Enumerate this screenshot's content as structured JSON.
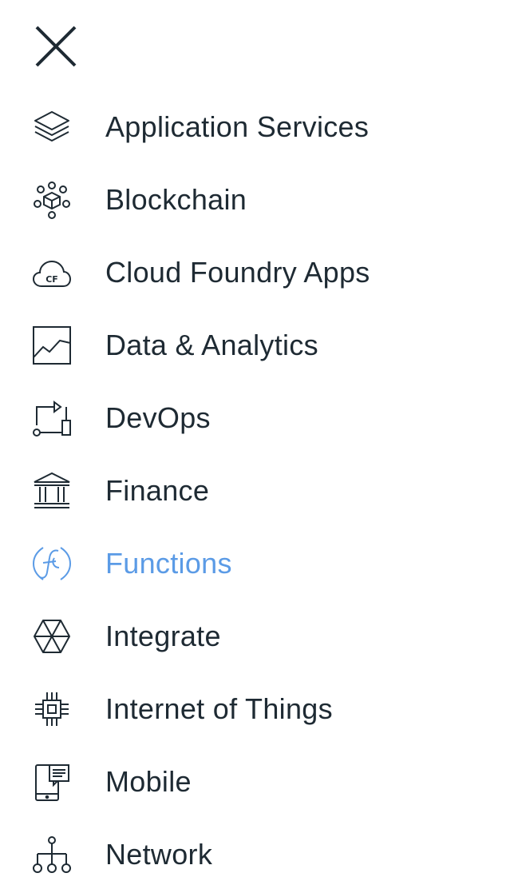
{
  "header": {
    "close_icon": "close-icon"
  },
  "menu": {
    "active_color": "#5b9be6",
    "text_color": "#1e2a33",
    "items": [
      {
        "label": "Application Services",
        "icon": "layers-icon",
        "active": false
      },
      {
        "label": "Blockchain",
        "icon": "blockchain-icon",
        "active": false
      },
      {
        "label": "Cloud Foundry Apps",
        "icon": "cloud-cf-icon",
        "active": false
      },
      {
        "label": "Data & Analytics",
        "icon": "chart-icon",
        "active": false
      },
      {
        "label": "DevOps",
        "icon": "devops-icon",
        "active": false
      },
      {
        "label": "Finance",
        "icon": "bank-icon",
        "active": false
      },
      {
        "label": "Functions",
        "icon": "functions-icon",
        "active": true
      },
      {
        "label": "Integrate",
        "icon": "integrate-icon",
        "active": false
      },
      {
        "label": "Internet of Things",
        "icon": "chip-icon",
        "active": false
      },
      {
        "label": "Mobile",
        "icon": "mobile-icon",
        "active": false
      },
      {
        "label": "Network",
        "icon": "network-icon",
        "active": false
      }
    ]
  }
}
